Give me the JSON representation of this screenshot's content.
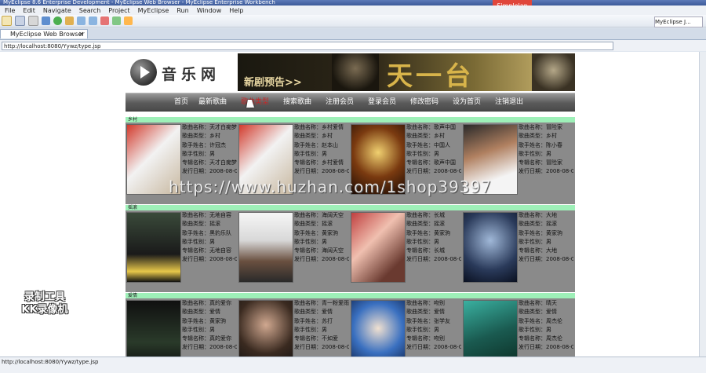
{
  "window": {
    "title": "MyEclipse 8.6 Enterprise Development - MyEclipse Web Browser - MyEclipse Enterprise Workbench",
    "badge": "Simplelap"
  },
  "menu": [
    "File",
    "Edit",
    "Navigate",
    "Search",
    "Project",
    "MyEclipse",
    "Run",
    "Window",
    "Help"
  ],
  "perspective": "MyEclipse J...",
  "tab": {
    "label": "MyEclipse Web Browser",
    "close": "✕"
  },
  "address": {
    "url": "http://localhost:8080/Yywz/type.jsp"
  },
  "site": {
    "logo_text": "音乐网",
    "banner_text": "新剧预告>>",
    "banner_title": "天一台"
  },
  "nav": [
    "首页",
    "最新歌曲",
    "歌曲类型",
    "搜索歌曲",
    "注册会员",
    "登录会员",
    "修改密码",
    "设为首页",
    "注销退出"
  ],
  "labels": {
    "name": "歌曲名称",
    "type": "歌曲类型",
    "singer": "歌手姓名",
    "gender": "歌手性别",
    "album": "专辑名称",
    "date": "发行日期"
  },
  "categories": [
    {
      "title": "乡村",
      "songs": [
        {
          "name": "天才白痴梦",
          "type": "乡村",
          "singer": "许冠杰",
          "gender": "男",
          "album": "天才白痴梦",
          "date": "2008-08-03"
        },
        {
          "name": "乡村爱情",
          "type": "乡村",
          "singer": "赵本山",
          "gender": "男",
          "album": "乡村爱情",
          "date": "2008-08-03"
        },
        {
          "name": "歌声中国",
          "type": "乡村",
          "singer": "中国人",
          "gender": "男",
          "album": "歌声中国",
          "date": "2008-08-03"
        },
        {
          "name": "冒险家",
          "type": "乡村",
          "singer": "陈小春",
          "gender": "男",
          "album": "冒险家",
          "date": "2008-08-03"
        }
      ]
    },
    {
      "title": "摇滚",
      "songs": [
        {
          "name": "无地自容",
          "type": "摇滚",
          "singer": "黑豹乐队",
          "gender": "男",
          "album": "无地自容",
          "date": "2008-08-03"
        },
        {
          "name": "海阔天空",
          "type": "摇滚",
          "singer": "黄家驹",
          "gender": "男",
          "album": "海阔天空",
          "date": "2008-08-03"
        },
        {
          "name": "长城",
          "type": "摇滚",
          "singer": "黄家驹",
          "gender": "男",
          "album": "长城",
          "date": "2008-08-03"
        },
        {
          "name": "大地",
          "type": "摇滚",
          "singer": "黄家驹",
          "gender": "男",
          "album": "大地",
          "date": "2008-08-03"
        }
      ]
    },
    {
      "title": "爱情",
      "songs": [
        {
          "name": "真的爱你",
          "type": "爱情",
          "singer": "黄家驹",
          "gender": "男",
          "album": "真的爱你",
          "date": "2008-08-03"
        },
        {
          "name": "青一粉爱雨淋手",
          "type": "爱情",
          "singer": "苏打",
          "gender": "男",
          "album": "不如爱",
          "date": "2008-08-03"
        },
        {
          "name": "吻别",
          "type": "爱情",
          "singer": "张学友",
          "gender": "男",
          "album": "吻别",
          "date": "2008-08-03"
        },
        {
          "name": "晴天",
          "type": "爱情",
          "singer": "周杰伦",
          "gender": "男",
          "album": "周杰伦",
          "date": "2008-08-03"
        }
      ]
    }
  ],
  "overlay": {
    "watermark": "https://www.huzhan.com/1shop39397",
    "recorder_line1": "录制工具",
    "recorder_line2": "KK录像机"
  },
  "status": {
    "text": "http://localhost:8080/Yywz/type.jsp"
  },
  "colors": {
    "category_bar": "#9ef0b8",
    "row_bg": "#8a8a8a",
    "active_nav": "#c62828"
  },
  "icons": [
    "new-icon",
    "save-icon",
    "print-icon",
    "debug-icon",
    "run-icon",
    "search-icon",
    "back-icon",
    "forward-icon",
    "stop-icon",
    "refresh-icon",
    "home-icon"
  ]
}
